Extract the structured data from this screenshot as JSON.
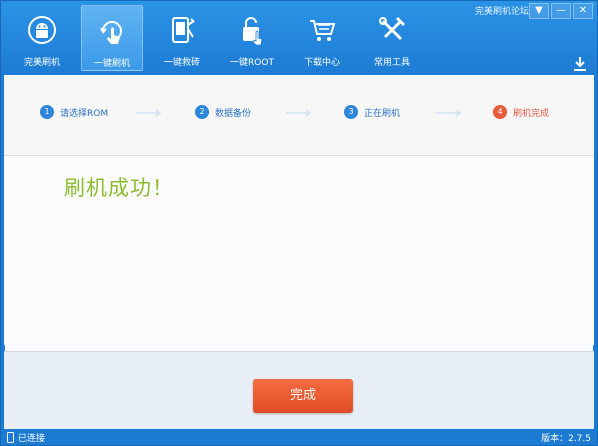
{
  "window": {
    "forum_link": "完美刷机论坛",
    "controls": [
      "▼",
      "—",
      "✕"
    ]
  },
  "nav": {
    "items": [
      {
        "label": "完美刷机",
        "icon": "android-icon"
      },
      {
        "label": "一键刷机",
        "icon": "tap-refresh-icon",
        "active": true
      },
      {
        "label": "一键救砖",
        "icon": "phone-wrench-icon"
      },
      {
        "label": "一键ROOT",
        "icon": "unlock-icon"
      },
      {
        "label": "下载中心",
        "icon": "cart-icon"
      },
      {
        "label": "常用工具",
        "icon": "tools-icon"
      }
    ]
  },
  "steps": {
    "items": [
      {
        "num": "1",
        "label": "请选择ROM"
      },
      {
        "num": "2",
        "label": "数据备份"
      },
      {
        "num": "3",
        "label": "正在刷机"
      },
      {
        "num": "4",
        "label": "刷机完成",
        "current": true
      }
    ]
  },
  "main": {
    "message": "刷机成功！"
  },
  "footer": {
    "finish_label": "完成"
  },
  "status": {
    "connection": "已连接",
    "version": "版本：2.7.5"
  },
  "colors": {
    "primary": "#1d7bd4",
    "success_green": "#8cbc2f",
    "orange": "#ea5b3c"
  }
}
